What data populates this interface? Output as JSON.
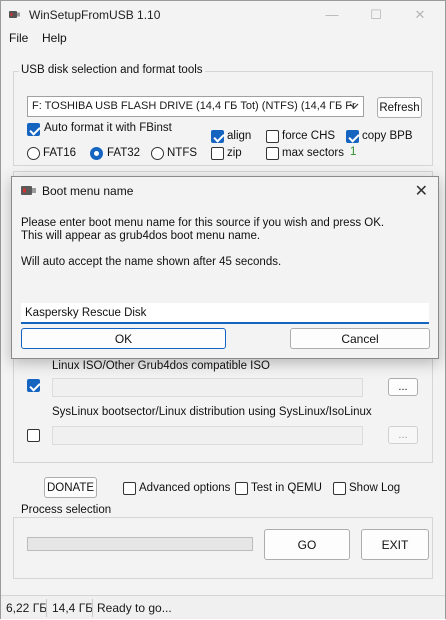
{
  "window": {
    "title": "WinSetupFromUSB 1.10",
    "controls": {
      "minimize": "—",
      "maximize": "☐",
      "close": "✕"
    }
  },
  "menu": {
    "file": "File",
    "help": "Help"
  },
  "usb_group": {
    "title": "USB disk selection and format tools",
    "selected_disk": "F: TOSHIBA USB FLASH DRIVE (14,4 ГБ Tot) (NTFS) (14,4 ГБ Fr",
    "refresh": "Refresh",
    "auto_format": {
      "label": "Auto format it with FBinst",
      "checked": true
    },
    "align": {
      "label": "align",
      "checked": true
    },
    "zip": {
      "label": "zip",
      "checked": false
    },
    "force_chs": {
      "label": "force CHS",
      "checked": false
    },
    "max_sectors": {
      "label": "max sectors",
      "checked": false
    },
    "copy_bpb": {
      "label": "copy BPB",
      "checked": true
    },
    "count_value": "1",
    "fs_options": [
      {
        "label": "FAT16",
        "selected": false
      },
      {
        "label": "FAT32",
        "selected": true
      },
      {
        "label": "NTFS",
        "selected": false
      }
    ]
  },
  "sources": {
    "linux_iso": {
      "label": "Linux ISO/Other Grub4dos compatible ISO",
      "checked": true,
      "browse": "..."
    },
    "syslinux": {
      "label": "SysLinux bootsector/Linux distribution using SysLinux/IsoLinux",
      "checked": false,
      "browse": "..."
    }
  },
  "bottom": {
    "donate": "DONATE",
    "advanced_options": {
      "label": "Advanced options",
      "checked": false
    },
    "test_qemu": {
      "label": "Test in QEMU",
      "checked": false
    },
    "show_log": {
      "label": "Show Log",
      "checked": false
    }
  },
  "process": {
    "title": "Process selection",
    "go": "GO",
    "exit": "EXIT"
  },
  "status": {
    "free": "6,22 ГБ",
    "total": "14,4 ГБ",
    "message": "Ready to go..."
  },
  "dialog": {
    "title": "Boot menu name",
    "close": "✕",
    "line1": "Please enter boot menu name for this source if you wish and press OK.",
    "line2": "This will appear as grub4dos boot menu name.",
    "line3": "Will auto accept the name shown after 45 seconds.",
    "input_value": "Kaspersky Rescue Disk",
    "ok": "OK",
    "cancel": "Cancel"
  },
  "colors": {
    "accent": "#1565c0",
    "window_bg": "#f3f3f3",
    "green_text": "#2f8f2f"
  },
  "icons": {
    "app": "usb-drive-icon",
    "dialog": "usb-drive-icon"
  }
}
